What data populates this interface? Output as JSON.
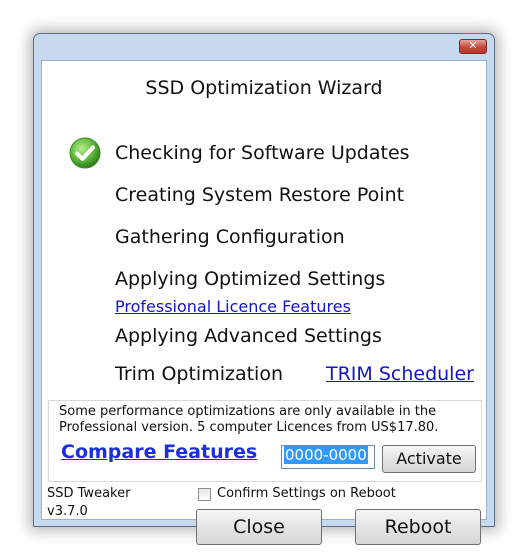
{
  "window": {
    "close_glyph": "✕"
  },
  "wizard": {
    "title": "SSD Optimization Wizard",
    "steps": [
      {
        "label": "Checking for Software Updates",
        "status": "done"
      },
      {
        "label": "Creating System Restore Point",
        "status": "pending"
      },
      {
        "label": "Gathering Configuration",
        "status": "pending"
      },
      {
        "label": "Applying Optimized Settings",
        "status": "pending"
      },
      {
        "label": "Applying Advanced Settings",
        "status": "pending"
      },
      {
        "label": "Trim Optimization",
        "status": "pending"
      }
    ],
    "professional_link": "Professional Licence Features",
    "trim_scheduler_link": "TRIM Scheduler"
  },
  "upsell": {
    "text": "Some performance optimizations are only available in the Professional version. 5 computer Licences from US$17.80.",
    "compare_link": "Compare Features",
    "code_value": "0000-0000",
    "activate_label": "Activate"
  },
  "footer": {
    "app_name": "SSD Tweaker",
    "version": "v3.7.0",
    "confirm_label": "Confirm Settings on Reboot",
    "confirm_checked": false,
    "close_label": "Close",
    "reboot_label": "Reboot"
  },
  "colors": {
    "link": "#1414c8",
    "check_green": "#5fb83a"
  }
}
